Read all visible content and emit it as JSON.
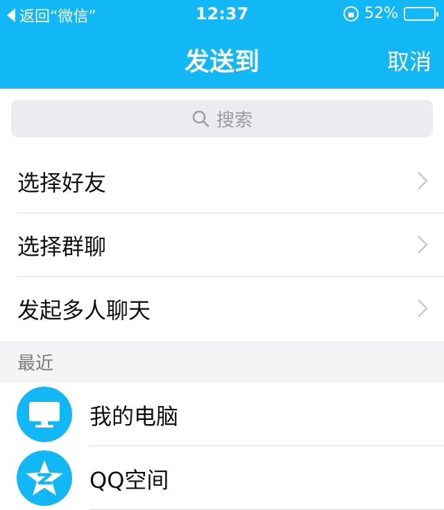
{
  "status_bar": {
    "back_label": "返回“微信”",
    "time": "12:37",
    "battery_percent": "52%",
    "battery_level": 0.52,
    "icons": [
      "back-arrow-icon",
      "rotation-lock-icon",
      "battery-icon"
    ]
  },
  "nav": {
    "title": "发送到",
    "cancel_label": "取消"
  },
  "search": {
    "placeholder": "搜索",
    "icon": "search-icon"
  },
  "menu": [
    {
      "label": "选择好友",
      "icon": "chevron-right-icon"
    },
    {
      "label": "选择群聊",
      "icon": "chevron-right-icon"
    },
    {
      "label": "发起多人聊天",
      "icon": "chevron-right-icon"
    }
  ],
  "recent": {
    "header": "最近",
    "items": [
      {
        "name": "我的电脑",
        "icon": "computer-icon"
      },
      {
        "name": "QQ空间",
        "icon": "qzone-star-icon"
      }
    ]
  },
  "colors": {
    "accent": "#12b7f5",
    "search_bg": "#ececf0",
    "section_bg": "#f4f4f6"
  }
}
